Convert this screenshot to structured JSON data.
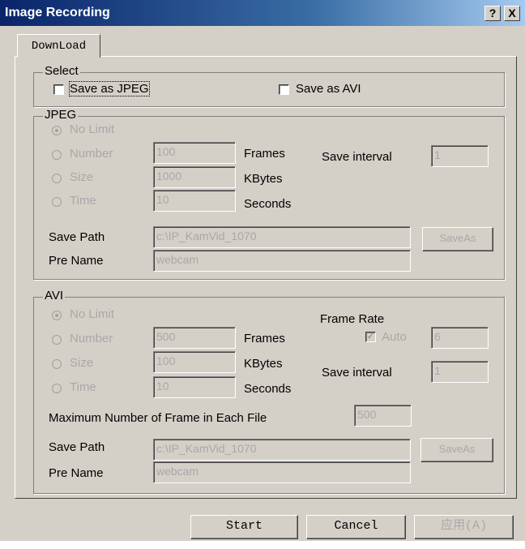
{
  "window": {
    "title": "Image Recording",
    "help_label": "?",
    "close_label": "X"
  },
  "tabs": [
    {
      "label": "DownLoad"
    }
  ],
  "select": {
    "legend": "Select",
    "save_jpeg": "Save as JPEG",
    "save_avi": "Save as AVI"
  },
  "jpeg": {
    "legend": "JPEG",
    "no_limit": "No Limit",
    "number": "Number",
    "size": "Size",
    "time": "Time",
    "number_value": "100",
    "size_value": "1000",
    "time_value": "10",
    "frames": "Frames",
    "kbytes": "KBytes",
    "seconds": "Seconds",
    "save_interval": "Save interval",
    "save_interval_value": "1",
    "save_path_label": "Save Path",
    "save_path": "c:\\IP_KamVid_1070",
    "saveas": "SaveAs",
    "pre_name_label": "Pre Name",
    "pre_name": "webcam"
  },
  "avi": {
    "legend": "AVI",
    "no_limit": "No Limit",
    "number": "Number",
    "size": "Size",
    "time": "Time",
    "number_value": "500",
    "size_value": "100",
    "time_value": "10",
    "frames": "Frames",
    "kbytes": "KBytes",
    "seconds": "Seconds",
    "frame_rate": "Frame Rate",
    "auto": "Auto",
    "frame_rate_value": "6",
    "save_interval": "Save interval",
    "save_interval_value": "1",
    "max_frames_label": "Maximum Number of Frame in Each File",
    "max_frames_value": "500",
    "save_path_label": "Save Path",
    "save_path": "c:\\IP_KamVid_1070",
    "saveas": "SaveAs",
    "pre_name_label": "Pre Name",
    "pre_name": "webcam"
  },
  "footer": {
    "start": "Start",
    "cancel": "Cancel",
    "apply": "应用(A)"
  }
}
